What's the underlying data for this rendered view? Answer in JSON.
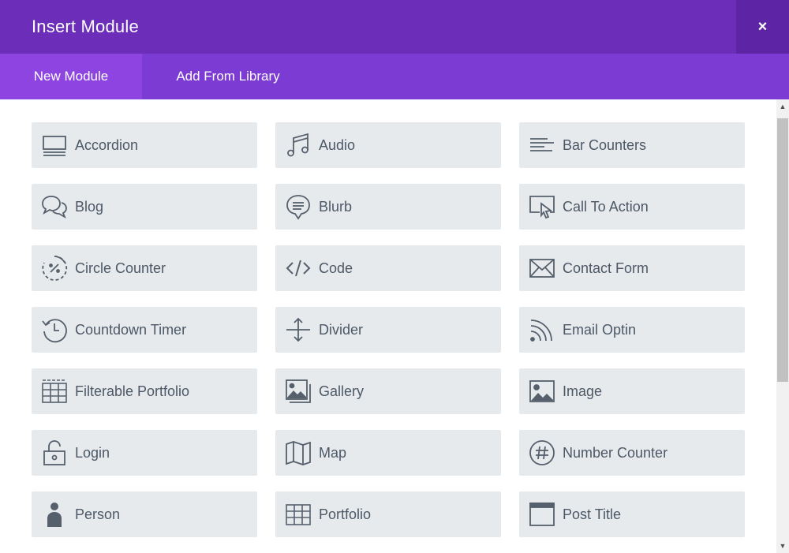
{
  "header": {
    "title": "Insert Module",
    "close_label": "×"
  },
  "tabs": [
    {
      "label": "New Module",
      "active": true
    },
    {
      "label": "Add From Library",
      "active": false
    }
  ],
  "modules": [
    {
      "label": "Accordion",
      "icon": "accordion-icon"
    },
    {
      "label": "Audio",
      "icon": "audio-icon"
    },
    {
      "label": "Bar Counters",
      "icon": "bar-counters-icon"
    },
    {
      "label": "Blog",
      "icon": "blog-icon"
    },
    {
      "label": "Blurb",
      "icon": "blurb-icon"
    },
    {
      "label": "Call To Action",
      "icon": "call-to-action-icon"
    },
    {
      "label": "Circle Counter",
      "icon": "circle-counter-icon"
    },
    {
      "label": "Code",
      "icon": "code-icon"
    },
    {
      "label": "Contact Form",
      "icon": "contact-form-icon"
    },
    {
      "label": "Countdown Timer",
      "icon": "countdown-timer-icon"
    },
    {
      "label": "Divider",
      "icon": "divider-icon"
    },
    {
      "label": "Email Optin",
      "icon": "email-optin-icon"
    },
    {
      "label": "Filterable Portfolio",
      "icon": "filterable-portfolio-icon"
    },
    {
      "label": "Gallery",
      "icon": "gallery-icon"
    },
    {
      "label": "Image",
      "icon": "image-icon"
    },
    {
      "label": "Login",
      "icon": "login-icon"
    },
    {
      "label": "Map",
      "icon": "map-icon"
    },
    {
      "label": "Number Counter",
      "icon": "number-counter-icon"
    },
    {
      "label": "Person",
      "icon": "person-icon"
    },
    {
      "label": "Portfolio",
      "icon": "portfolio-icon"
    },
    {
      "label": "Post Title",
      "icon": "post-title-icon"
    }
  ],
  "colors": {
    "header_bg": "#6c2eb9",
    "tabs_bg": "#7c3bd3",
    "active_tab_bg": "#8e44e0",
    "module_bg": "#e7eaed",
    "module_text": "#4c5866"
  }
}
